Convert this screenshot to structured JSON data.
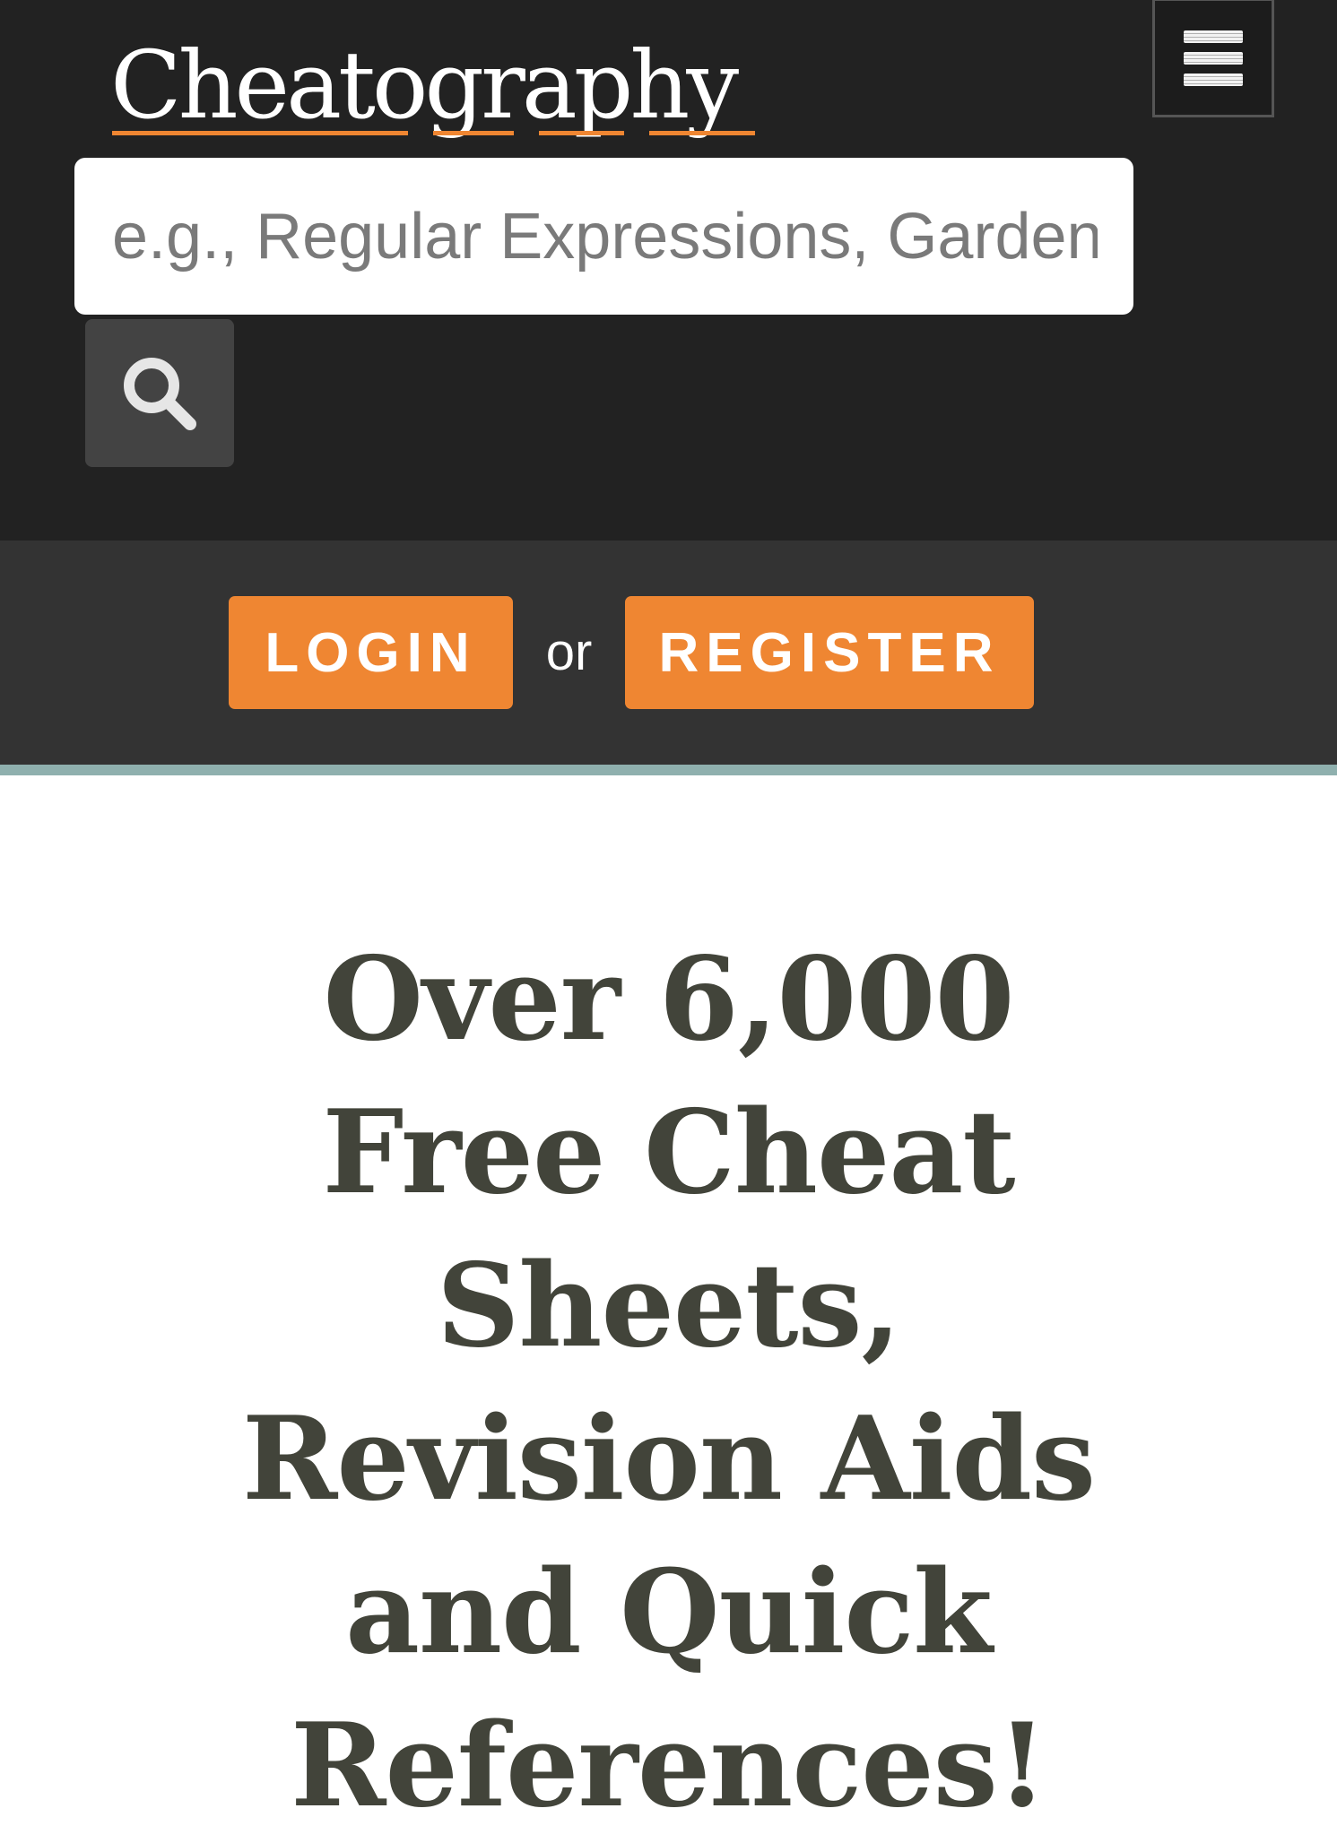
{
  "header": {
    "logo_text": "Cheatography",
    "menu_icon": "hamburger-menu-icon",
    "search": {
      "placeholder": "e.g., Regular Expressions, Gardening",
      "value": "",
      "button_icon": "search-icon"
    }
  },
  "auth": {
    "login_label": "LOGIN",
    "separator": "or",
    "register_label": "REGISTER"
  },
  "hero": {
    "headline": "Over 6,000 Free Cheat Sheets, Revision Aids and Quick References!"
  },
  "colors": {
    "header_background": "#222222",
    "auth_background": "#333333",
    "accent_orange": "#ef8632",
    "divider_teal": "#8fb0ae",
    "headline_text": "#42443a"
  }
}
